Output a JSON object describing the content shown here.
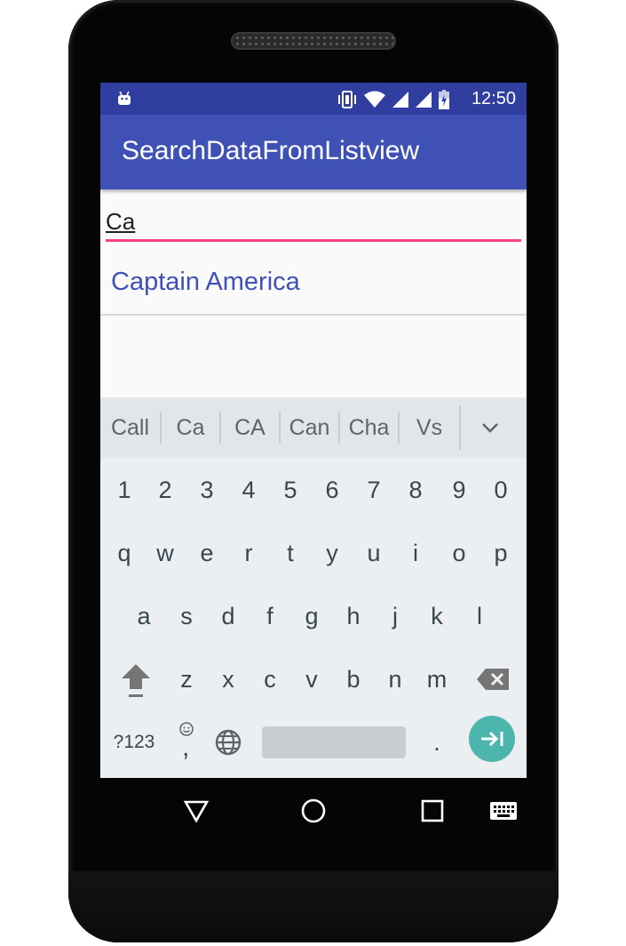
{
  "status_bar": {
    "time": "12:50",
    "icons": [
      "android-debug-icon",
      "vibrate-icon",
      "wifi-icon",
      "signal-icon",
      "signal-2-icon",
      "battery-charging-icon"
    ]
  },
  "app_bar": {
    "title": "SearchDataFromListview"
  },
  "search": {
    "value": "Ca",
    "underline_color": "#ff4081"
  },
  "list": {
    "items": [
      {
        "label": "Captain America"
      }
    ]
  },
  "keyboard": {
    "suggestions": [
      "Call",
      "Ca",
      "CA",
      "Can",
      "Cha",
      "Vs"
    ],
    "rows": {
      "numbers": [
        "1",
        "2",
        "3",
        "4",
        "5",
        "6",
        "7",
        "8",
        "9",
        "0"
      ],
      "row1": [
        "q",
        "w",
        "e",
        "r",
        "t",
        "y",
        "u",
        "i",
        "o",
        "p"
      ],
      "row2": [
        "a",
        "s",
        "d",
        "f",
        "g",
        "h",
        "j",
        "k",
        "l"
      ],
      "row3": [
        "z",
        "x",
        "c",
        "v",
        "b",
        "n",
        "m"
      ]
    },
    "symbols_label": "?123",
    "comma_label": ",",
    "period_label": ".",
    "icons": [
      "shift-icon",
      "backspace-icon",
      "emoji-icon",
      "globe-icon",
      "next-icon",
      "chevron-down-icon"
    ]
  },
  "navigation": {
    "icons": [
      "back-icon",
      "home-icon",
      "recents-icon",
      "keyboard-switch-icon"
    ]
  },
  "colors": {
    "status_bar": "#303f9f",
    "app_bar": "#3f51b5",
    "accent": "#ff4081",
    "list_text": "#3f51b5",
    "enter_key": "#4db6ac"
  }
}
